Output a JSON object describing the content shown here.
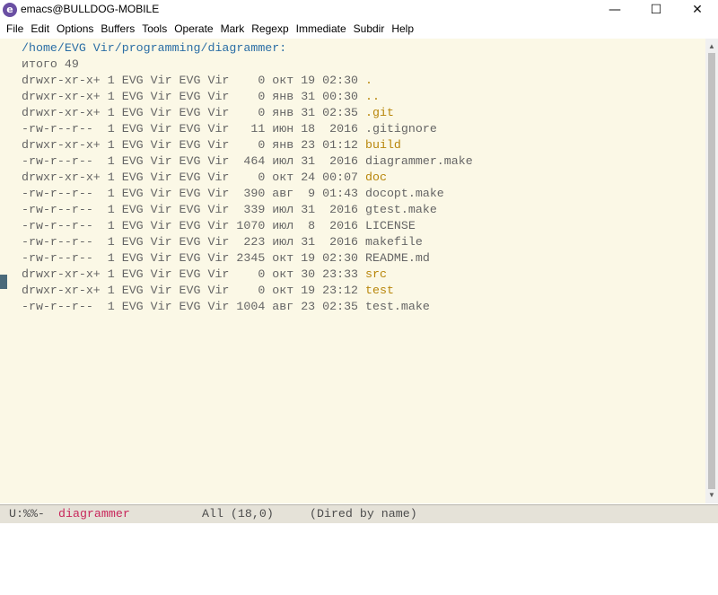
{
  "window": {
    "title": "emacs@BULLDOG-MOBILE",
    "app_icon": "emacs-icon",
    "controls": {
      "minimize": "—",
      "maximize": "☐",
      "close": "✕"
    }
  },
  "menubar": [
    "File",
    "Edit",
    "Options",
    "Buffers",
    "Tools",
    "Operate",
    "Mark",
    "Regexp",
    "Immediate",
    "Subdir",
    "Help"
  ],
  "buffer": {
    "directory": "/home/EVG Vir/programming/diagrammer:",
    "total_line": "итого 49",
    "entries": [
      {
        "prefix": "drwxr-xr-x+ 1 EVG Vir EVG Vir    0 окт 19 02:30 ",
        "name": ".",
        "is_dir": true
      },
      {
        "prefix": "drwxr-xr-x+ 1 EVG Vir EVG Vir    0 янв 31 00:30 ",
        "name": "..",
        "is_dir": true
      },
      {
        "prefix": "drwxr-xr-x+ 1 EVG Vir EVG Vir    0 янв 31 02:35 ",
        "name": ".git",
        "is_dir": true
      },
      {
        "prefix": "-rw-r--r--  1 EVG Vir EVG Vir   11 июн 18  2016 ",
        "name": ".gitignore",
        "is_dir": false
      },
      {
        "prefix": "drwxr-xr-x+ 1 EVG Vir EVG Vir    0 янв 23 01:12 ",
        "name": "build",
        "is_dir": true
      },
      {
        "prefix": "-rw-r--r--  1 EVG Vir EVG Vir  464 июл 31  2016 ",
        "name": "diagrammer.make",
        "is_dir": false
      },
      {
        "prefix": "drwxr-xr-x+ 1 EVG Vir EVG Vir    0 окт 24 00:07 ",
        "name": "doc",
        "is_dir": true
      },
      {
        "prefix": "-rw-r--r--  1 EVG Vir EVG Vir  390 авг  9 01:43 ",
        "name": "docopt.make",
        "is_dir": false
      },
      {
        "prefix": "-rw-r--r--  1 EVG Vir EVG Vir  339 июл 31  2016 ",
        "name": "gtest.make",
        "is_dir": false
      },
      {
        "prefix": "-rw-r--r--  1 EVG Vir EVG Vir 1070 июл  8  2016 ",
        "name": "LICENSE",
        "is_dir": false
      },
      {
        "prefix": "-rw-r--r--  1 EVG Vir EVG Vir  223 июл 31  2016 ",
        "name": "makefile",
        "is_dir": false
      },
      {
        "prefix": "-rw-r--r--  1 EVG Vir EVG Vir 2345 окт 19 02:30 ",
        "name": "README.md",
        "is_dir": false
      },
      {
        "prefix": "drwxr-xr-x+ 1 EVG Vir EVG Vir    0 окт 30 23:33 ",
        "name": "src",
        "is_dir": true
      },
      {
        "prefix": "drwxr-xr-x+ 1 EVG Vir EVG Vir    0 окт 19 23:12 ",
        "name": "test",
        "is_dir": true
      },
      {
        "prefix": "-rw-r--r--  1 EVG Vir EVG Vir 1004 авг 23 02:35 ",
        "name": "test.make",
        "is_dir": false
      }
    ]
  },
  "modeline": {
    "status": "U:%%-",
    "buffer_name": "diagrammer",
    "position": "All (18,0)",
    "mode": "(Dired by name)"
  },
  "colors": {
    "buffer_bg": "#fbf8e6",
    "directory_name": "#b8860b",
    "header": "#2b6ea5",
    "modeline_buffer": "#c8275b"
  }
}
